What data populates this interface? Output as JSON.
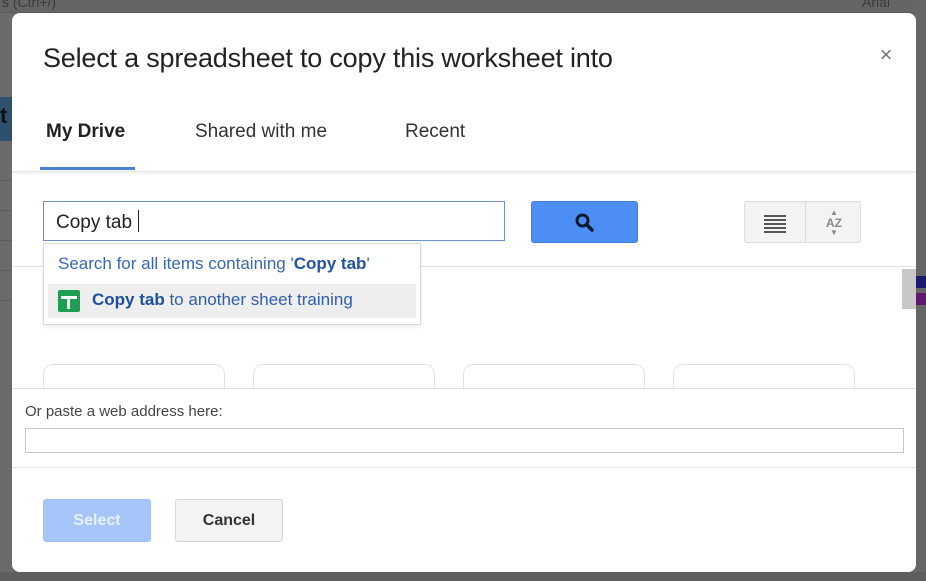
{
  "background": {
    "toolbar_fragment_left": "s (Ctrl+/)",
    "toolbar_fragment_right": "Arial",
    "cell_fragment": "t",
    "colors": {
      "navy_cell": "#1a1a6e",
      "purple_cell": "#5e1a6e"
    }
  },
  "dialog": {
    "title": "Select a spreadsheet to copy this worksheet into",
    "close_icon": "×",
    "tabs": [
      {
        "label": "My Drive",
        "active": true
      },
      {
        "label": "Shared with me",
        "active": false
      },
      {
        "label": "Recent",
        "active": false
      }
    ],
    "search": {
      "value": "Copy tab",
      "button_icon": "search-icon"
    },
    "view_buttons": {
      "list_icon": "list-view-icon",
      "sort_icon": "sort-az-icon",
      "sort_label": "AZ"
    },
    "suggestions": {
      "search_all_prefix": "Search for all items containing '",
      "search_all_term": "Copy tab",
      "search_all_suffix": "'",
      "items": [
        {
          "icon": "google-sheets-icon",
          "match": "Copy tab",
          "rest": " to another sheet training"
        }
      ]
    },
    "paste": {
      "label": "Or paste a web address here:",
      "value": ""
    },
    "buttons": {
      "select": "Select",
      "cancel": "Cancel"
    },
    "colors": {
      "accent": "#4d8ef5",
      "tab_underline": "#4d7fd0",
      "link": "#3867b0",
      "sheets_green": "#1e9e52",
      "select_disabled": "#a6c6fa"
    }
  }
}
